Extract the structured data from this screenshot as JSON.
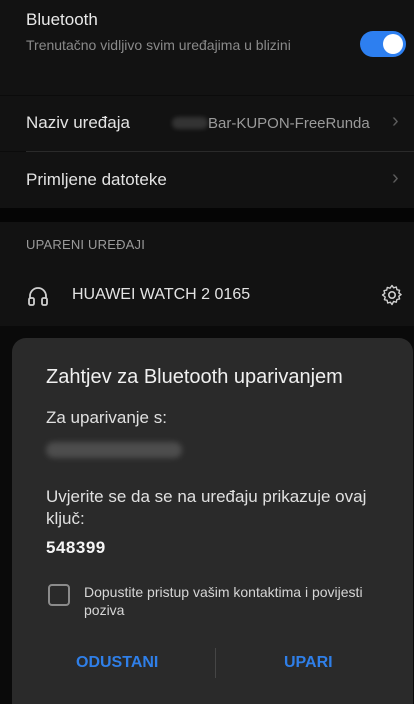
{
  "bluetooth": {
    "title": "Bluetooth",
    "subtitle": "Trenutačno vidljivo svim uređajima u blizini",
    "toggle_state": "on",
    "accent_color": "#2d7ff0"
  },
  "device_name": {
    "label": "Naziv uređaja",
    "value": "Bar-KUPON-FreeRunda"
  },
  "received_files": {
    "label": "Primljene datoteke"
  },
  "paired_devices": {
    "header": "UPARENI UREĐAJI",
    "items": [
      {
        "name": "HUAWEI WATCH 2 0165",
        "icon": "headset-icon",
        "action_icon": "gear-icon"
      }
    ]
  },
  "dialog": {
    "title": "Zahtjev za Bluetooth uparivanjem",
    "pair_with_label": "Za uparivanje s:",
    "confirm_text": "Uvjerite se da se na uređaju prikazuje ovaj ključ:",
    "passkey": "548399",
    "checkbox_label": "Dopustite pristup vašim kontaktima i povijesti poziva",
    "checkbox_checked": false,
    "cancel_label": "ODUSTANI",
    "confirm_label": "UPARI",
    "button_color": "#2f7fe8"
  }
}
